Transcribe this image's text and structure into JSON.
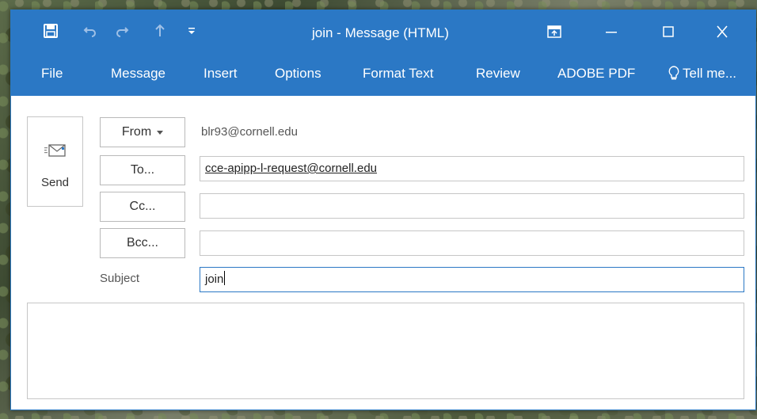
{
  "window": {
    "title": "join - Message (HTML)"
  },
  "quick_access": {
    "save_icon": "save-icon",
    "undo_icon": "undo-icon",
    "redo_icon": "redo-icon",
    "up_icon": "up-arrow-icon",
    "customize_icon": "customize-dropdown-icon"
  },
  "ribbon": {
    "tabs": [
      {
        "label": "File"
      },
      {
        "label": "Message"
      },
      {
        "label": "Insert"
      },
      {
        "label": "Options"
      },
      {
        "label": "Format Text"
      },
      {
        "label": "Review"
      },
      {
        "label": "ADOBE PDF"
      },
      {
        "label": "Tell me..."
      }
    ]
  },
  "compose": {
    "send_label": "Send",
    "from_label": "From",
    "from_value": "blr93@cornell.edu",
    "to_label": "To...",
    "to_value": "cce-apipp-l-request@cornell.edu",
    "cc_label": "Cc...",
    "cc_value": "",
    "bcc_label": "Bcc...",
    "bcc_value": "",
    "subject_label": "Subject",
    "subject_value": "join",
    "body_value": ""
  },
  "colors": {
    "accent": "#2b78c5",
    "window_bg": "#ffffff",
    "border": "#c6c6c6"
  }
}
